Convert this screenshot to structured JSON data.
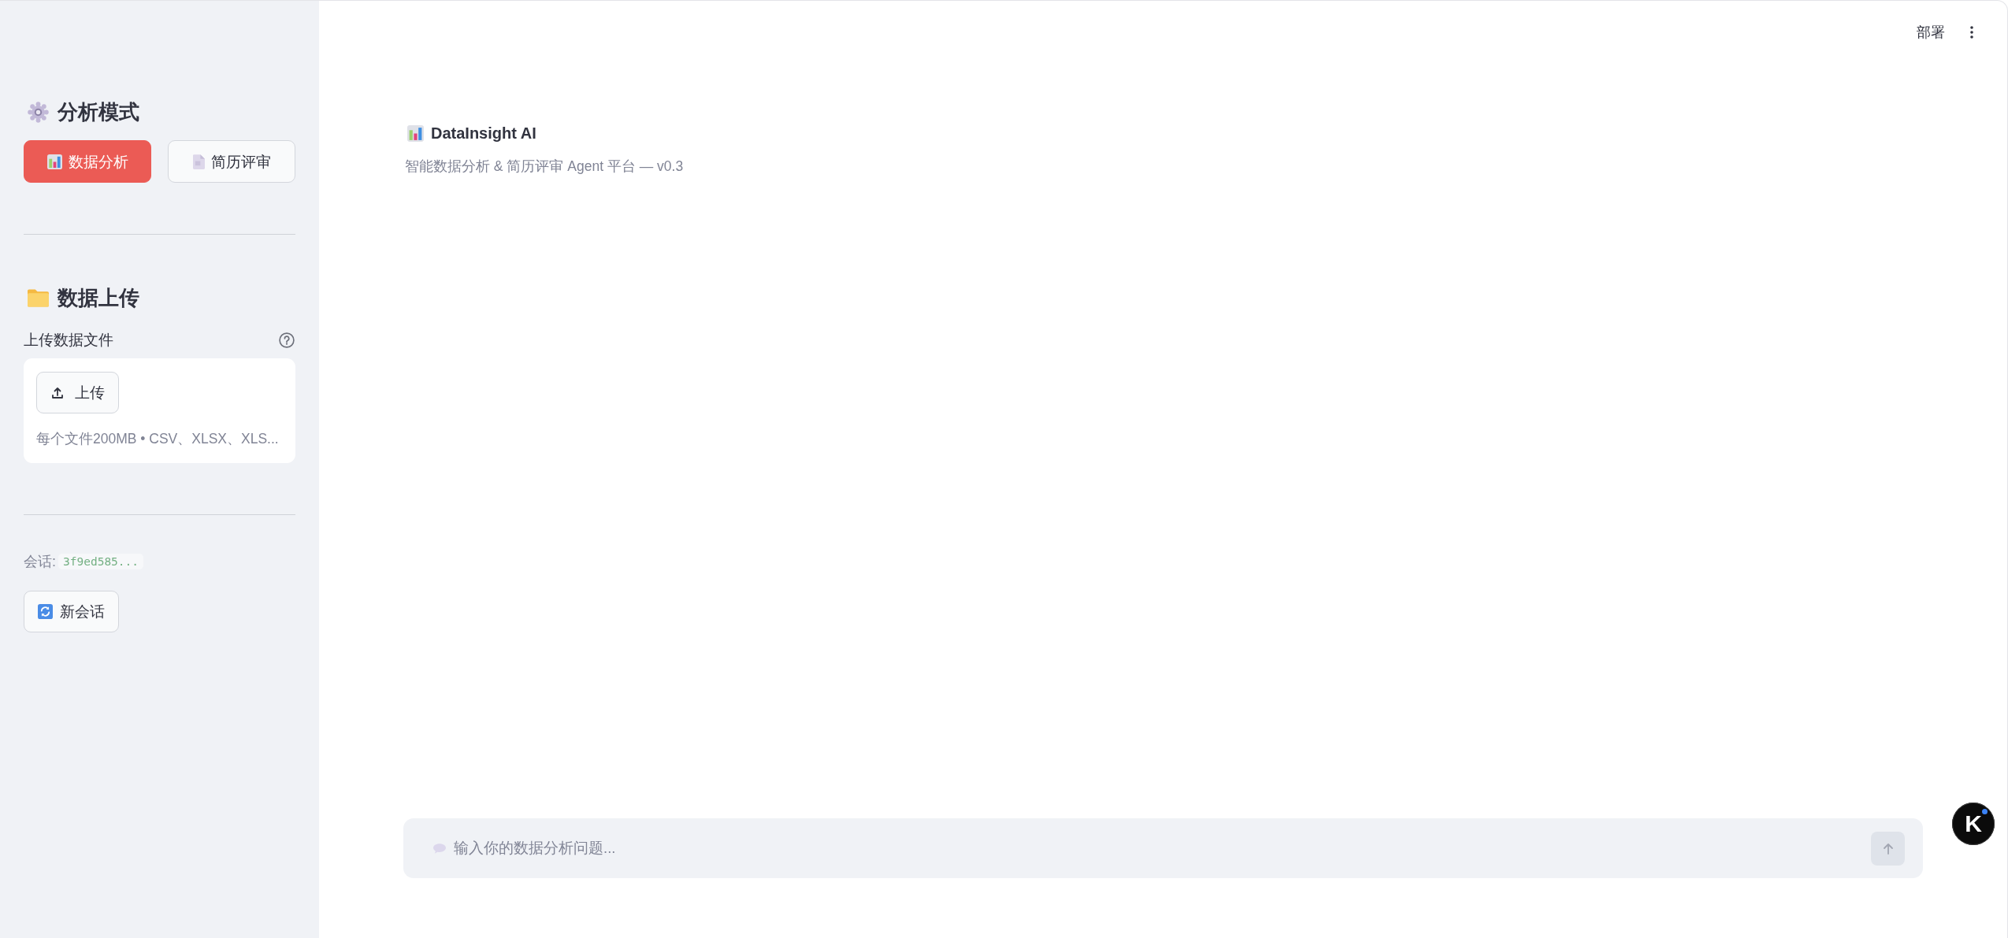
{
  "sidebar": {
    "mode_section": {
      "heading": "分析模式",
      "buttons": [
        {
          "label": "数据分析",
          "selected": true
        },
        {
          "label": "简历评审",
          "selected": false
        }
      ]
    },
    "upload_section": {
      "heading": "数据上传",
      "field_label": "上传数据文件",
      "upload_button": "上传",
      "limits": "每个文件200MB • CSV、XLSX、XLS..."
    },
    "session": {
      "label": "会话:",
      "id": "3f9ed585..."
    },
    "new_session_button": "新会话"
  },
  "header": {
    "deploy_button": "部署"
  },
  "main": {
    "title": "DataInsight AI",
    "subtitle": "智能数据分析 & 简历评审 Agent 平台 — v0.3"
  },
  "chat_input": {
    "placeholder": "输入你的数据分析问题..."
  },
  "floating_button": {
    "label": "K"
  }
}
